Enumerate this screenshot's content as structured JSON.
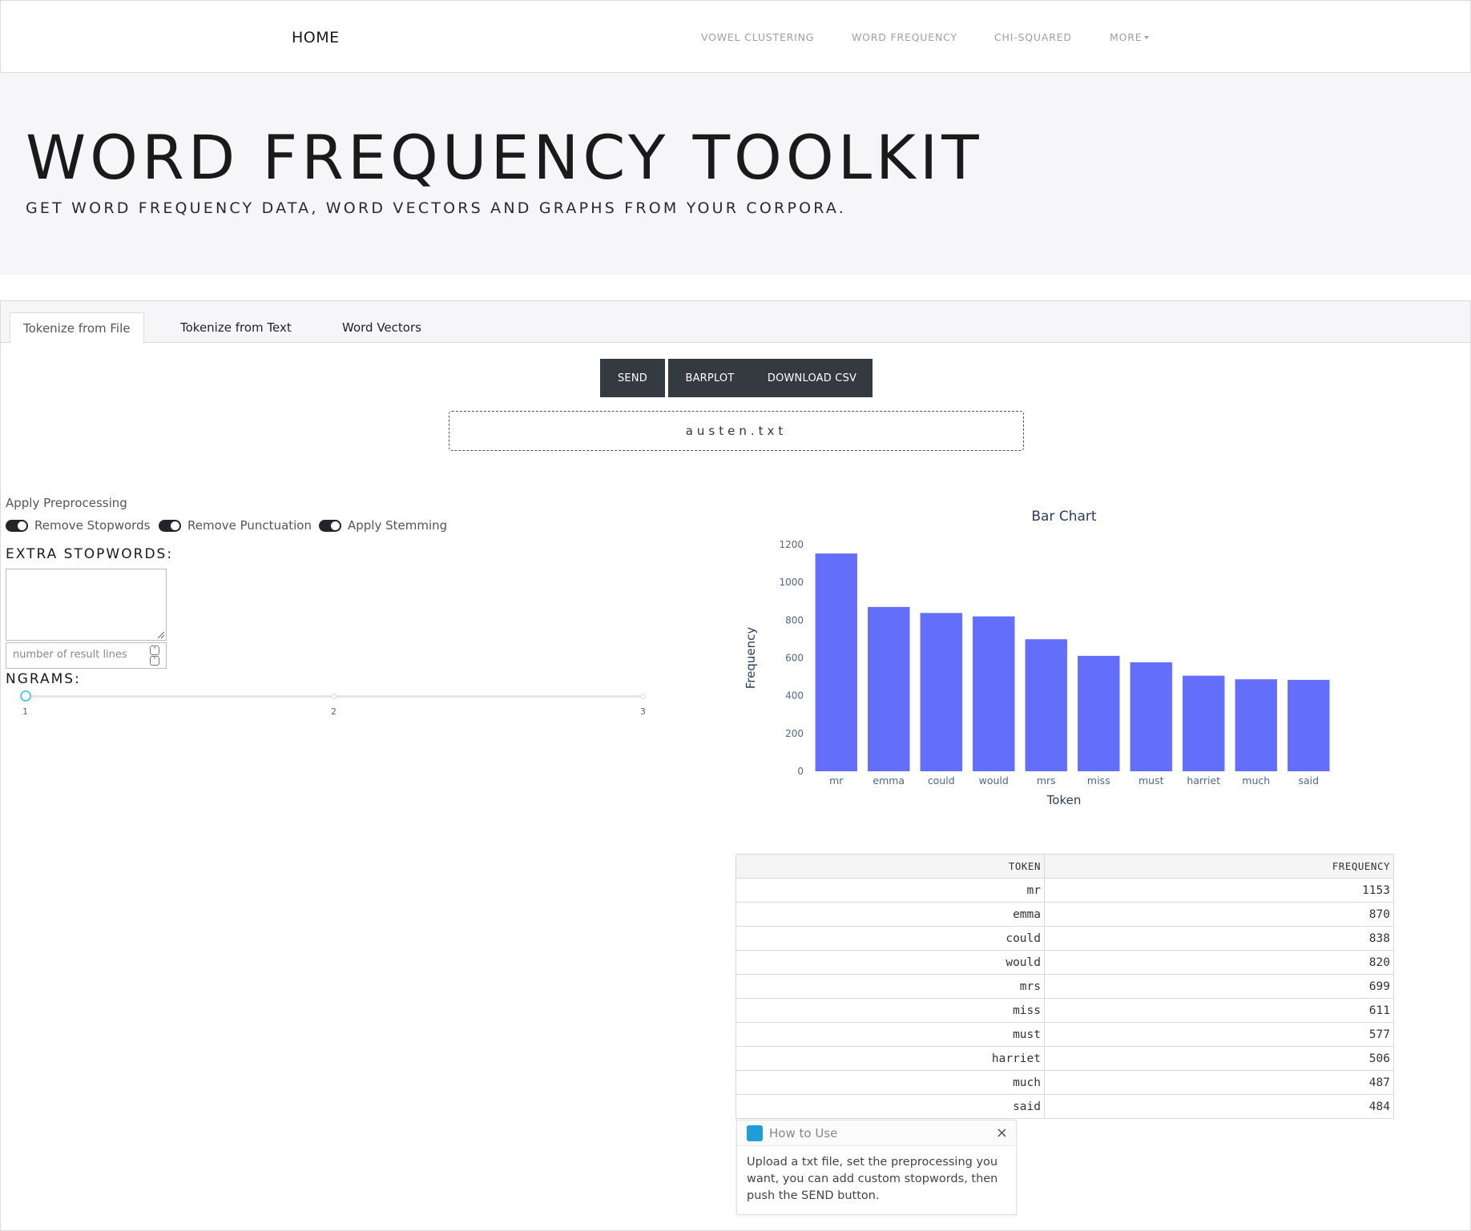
{
  "nav": {
    "brand": "HOME",
    "links": [
      "VOWEL CLUSTERING",
      "WORD FREQUENCY",
      "CHI-SQUARED",
      "MORE"
    ]
  },
  "hero": {
    "title": "WORD FREQUENCY TOOLKIT",
    "subtitle": "GET WORD FREQUENCY DATA, WORD VECTORS AND GRAPHS FROM YOUR CORPORA."
  },
  "tabs": [
    {
      "label": "Tokenize from File",
      "active": true
    },
    {
      "label": "Tokenize from Text",
      "active": false
    },
    {
      "label": "Word Vectors",
      "active": false
    }
  ],
  "actions": {
    "send": "SEND",
    "barplot": "BARPLOT",
    "download": "DOWNLOAD CSV"
  },
  "file": {
    "name": "austen.txt"
  },
  "preprocessing": {
    "label": "Apply Preprocessing",
    "options": [
      {
        "label": "Remove Stopwords",
        "on": true
      },
      {
        "label": "Remove Punctuation",
        "on": true
      },
      {
        "label": "Apply Stemming",
        "on": true
      }
    ]
  },
  "stopwords": {
    "label": "EXTRA STOPWORDS:",
    "value": ""
  },
  "result_lines": {
    "placeholder": "number of result lines",
    "value": ""
  },
  "ngrams": {
    "label": "NGRAMS:",
    "marks": [
      "1",
      "2",
      "3"
    ],
    "value": 1
  },
  "chart_data": {
    "type": "bar",
    "title": "Bar Chart",
    "xlabel": "Token",
    "ylabel": "Frequency",
    "categories": [
      "mr",
      "emma",
      "could",
      "would",
      "mrs",
      "miss",
      "must",
      "harriet",
      "much",
      "said"
    ],
    "values": [
      1153,
      870,
      838,
      820,
      699,
      611,
      577,
      506,
      487,
      484
    ],
    "ylim": [
      0,
      1200
    ],
    "yticks": [
      0,
      200,
      400,
      600,
      800,
      1000,
      1200
    ],
    "color": "#636efa"
  },
  "table": {
    "headers": [
      "TOKEN",
      "FREQUENCY"
    ],
    "rows": [
      [
        "mr",
        "1153"
      ],
      [
        "emma",
        "870"
      ],
      [
        "could",
        "838"
      ],
      [
        "would",
        "820"
      ],
      [
        "mrs",
        "699"
      ],
      [
        "miss",
        "611"
      ],
      [
        "must",
        "577"
      ],
      [
        "harriet",
        "506"
      ],
      [
        "much",
        "487"
      ],
      [
        "said",
        "484"
      ]
    ]
  },
  "toast": {
    "title": "How to Use",
    "close": "×",
    "body": "Upload a txt file, set the preprocessing you want, you can add custom stopwords, then push the SEND button.",
    "accent": "#229ed6"
  }
}
